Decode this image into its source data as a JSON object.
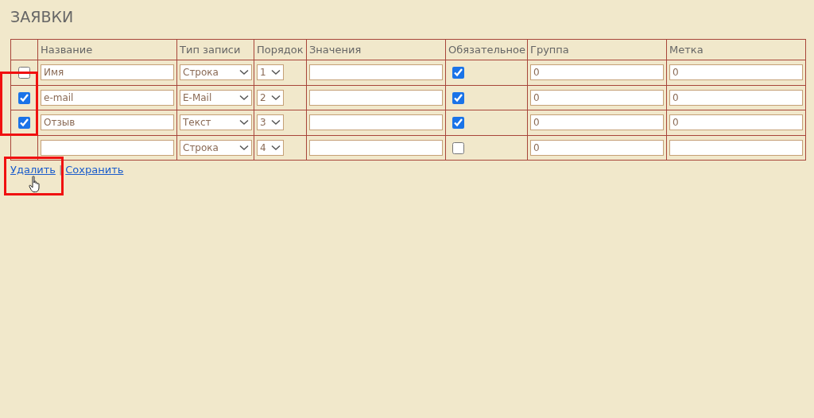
{
  "title": "ЗАЯВКИ",
  "table": {
    "columns": [
      "Название",
      "Тип записи",
      "Порядок",
      "Значения",
      "Обязательное",
      "Группа",
      "Метка"
    ],
    "rows": [
      {
        "kind": "existing",
        "selected": false,
        "name": "Имя",
        "type": "Строка",
        "order": "1",
        "values": "",
        "required": true,
        "group": "0",
        "label": "0"
      },
      {
        "kind": "existing",
        "selected": true,
        "name": "e-mail",
        "type": "E-Mail",
        "order": "2",
        "values": "",
        "required": true,
        "group": "0",
        "label": "0"
      },
      {
        "kind": "existing",
        "selected": true,
        "name": "Отзыв",
        "type": "Текст",
        "order": "3",
        "values": "",
        "required": true,
        "group": "0",
        "label": "0"
      },
      {
        "kind": "new",
        "name": "",
        "type": "Строка",
        "order": "4",
        "values": "",
        "required": false,
        "group": "0",
        "label": ""
      }
    ]
  },
  "links": [
    "Удалить",
    "Сохранить"
  ],
  "separator": "|"
}
